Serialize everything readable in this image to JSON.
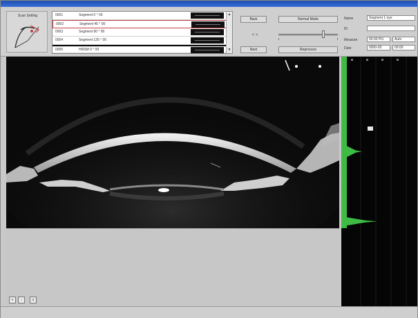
{
  "window": {
    "title": "",
    "colors": {
      "frame": "#c9c9c9",
      "image_bg": "#0a0a0a",
      "signal": "#3dbb45",
      "selected_row": "#c23b3b"
    }
  },
  "scan_icon": {
    "label": "Scan Setting",
    "icon": "eye-scan-icon"
  },
  "scan_list": {
    "rows": [
      {
        "id": "0001",
        "name": "Segment 0 ° 00"
      },
      {
        "id": "0002",
        "name": "Segment 45 ° 00"
      },
      {
        "id": "0003",
        "name": "Segment 90 ° 00"
      },
      {
        "id": "0004",
        "name": "Segment 135 ° 00"
      },
      {
        "id": "0005",
        "name": "HRSM 0 ° 00"
      }
    ],
    "selected_index": 1
  },
  "controls": {
    "back_label": "Back",
    "next_label": "Next",
    "mode_label": "Normal Mode",
    "reprocess_label": "Reprocess",
    "arrows_label": "< >",
    "slider_level": 0.75
  },
  "info": {
    "name_label": "Name",
    "name_value": "Segment 1 eye",
    "id_label": "ID",
    "id_value": "",
    "measure_label": "Measure",
    "measure_value": "00:00 Pt1",
    "measure_value2": "Auto",
    "date_label": "Date",
    "date_value": "0000-00",
    "date_value2": "00:00"
  },
  "mini_buttons": [
    "+",
    "-",
    "x"
  ],
  "signal": {
    "marker_label": "",
    "peak1_level": 0.38,
    "peak2_level": 0.66
  }
}
